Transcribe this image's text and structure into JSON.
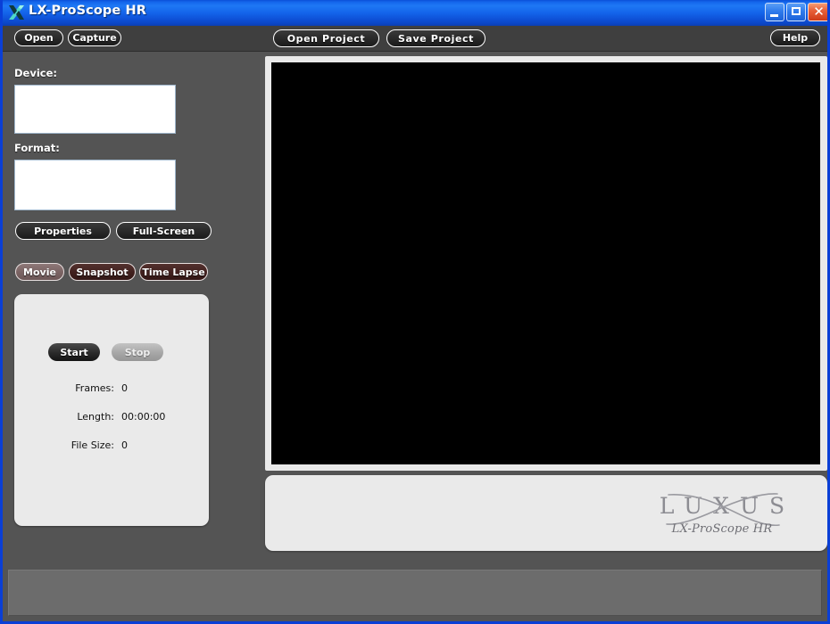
{
  "window": {
    "title": "LX-ProScope HR",
    "icon": "app-x-icon",
    "controls": {
      "minimize": "minimize-icon",
      "maximize": "maximize-icon",
      "close": "✕"
    },
    "accent_color": "#1466ec",
    "body_color": "#545454",
    "toolbar_color": "#3f3f3f"
  },
  "toolbar": {
    "open": "Open",
    "capture": "Capture",
    "open_project": "Open Project",
    "save_project": "Save Project",
    "help": "Help"
  },
  "sidebar": {
    "device_label": "Device:",
    "device_value": "",
    "format_label": "Format:",
    "format_value": "",
    "properties": "Properties",
    "fullscreen": "Full-Screen",
    "modes": [
      {
        "label": "Movie",
        "active": true
      },
      {
        "label": "Snapshot",
        "active": false
      },
      {
        "label": "Time Lapse",
        "active": false
      }
    ]
  },
  "capture_panel": {
    "start": "Start",
    "stop": "Stop",
    "stats": [
      {
        "label": "Frames:",
        "value": "0"
      },
      {
        "label": "Length:",
        "value": "00:00:00"
      },
      {
        "label": "File Size:",
        "value": "0"
      }
    ]
  },
  "preview": {
    "screen_color": "#000000"
  },
  "branding": {
    "wordmark": "LUXUS",
    "product": "LX-ProScope HR"
  },
  "statusbar": {
    "text": ""
  }
}
